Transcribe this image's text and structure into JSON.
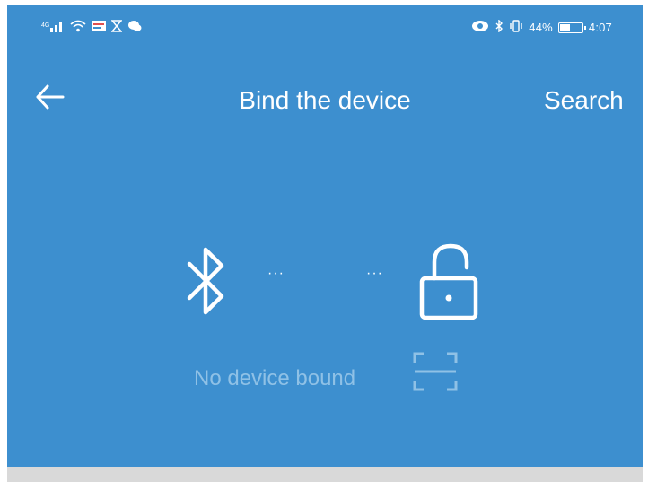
{
  "status_bar": {
    "left_icons": [
      "signal-icon",
      "wifi-icon",
      "message-icon",
      "hourglass-icon",
      "chat-icon"
    ],
    "battery_percent": "44%",
    "time": "4:07"
  },
  "header": {
    "title": "Bind the device",
    "search_label": "Search"
  },
  "binding": {
    "status_text": "No device bound",
    "dots_left": "···",
    "dots_right": "···"
  },
  "colors": {
    "primary": "#3d8fcf",
    "muted_text": "#8fc1e6",
    "footer_bg": "#d9d9d9"
  }
}
